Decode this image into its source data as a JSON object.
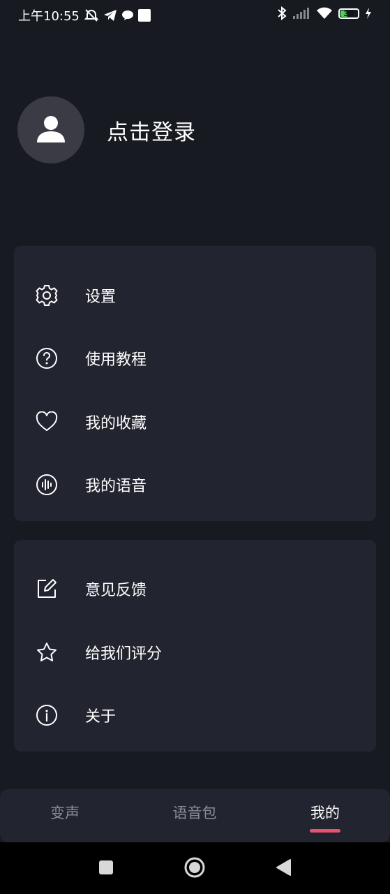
{
  "status_bar": {
    "time": "上午10:55",
    "battery_level": "38",
    "left_icons": [
      "alarm-off-icon",
      "telegram-icon",
      "chat-bubble-icon",
      "square-notification-icon"
    ],
    "right_icons": [
      "bluetooth-icon",
      "signal-icon",
      "wifi-icon",
      "battery-icon",
      "charging-icon"
    ]
  },
  "profile": {
    "login_label": "点击登录",
    "avatar_icon": "user-icon"
  },
  "menu_group_1": {
    "items": [
      {
        "label": "设置",
        "icon": "gear-icon"
      },
      {
        "label": "使用教程",
        "icon": "help-circle-icon"
      },
      {
        "label": "我的收藏",
        "icon": "heart-icon"
      },
      {
        "label": "我的语音",
        "icon": "voice-wave-icon"
      }
    ]
  },
  "menu_group_2": {
    "items": [
      {
        "label": "意见反馈",
        "icon": "edit-icon"
      },
      {
        "label": "给我们评分",
        "icon": "star-icon"
      },
      {
        "label": "关于",
        "icon": "info-icon"
      }
    ]
  },
  "tab_bar": {
    "tabs": [
      {
        "label": "变声",
        "active": false
      },
      {
        "label": "语音包",
        "active": false
      },
      {
        "label": "我的",
        "active": true
      }
    ],
    "active_color": "#e8516f"
  },
  "colors": {
    "background": "#181a22",
    "card": "#22242f",
    "accent": "#e8516f"
  }
}
